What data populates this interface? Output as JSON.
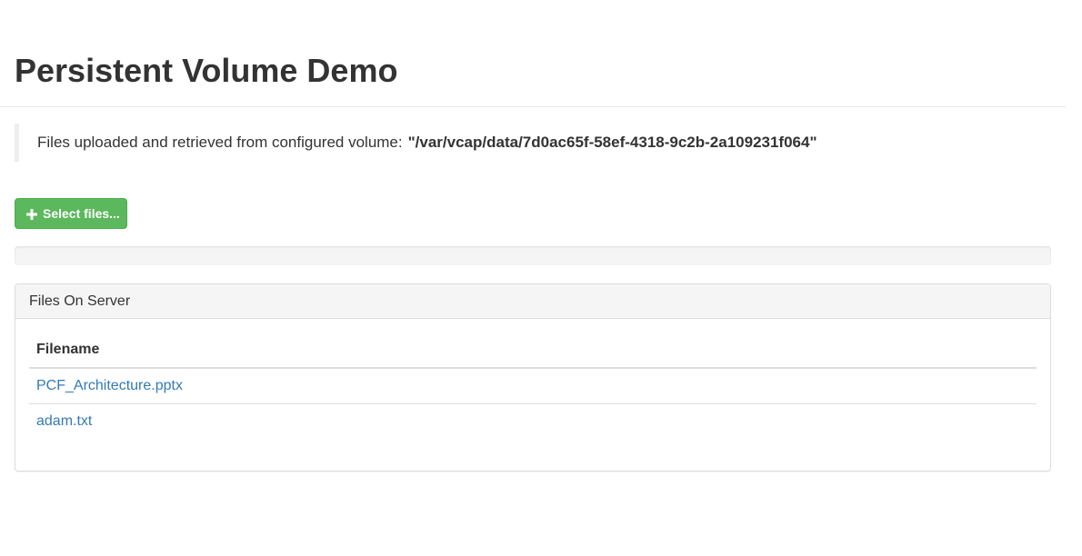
{
  "header": {
    "title": "Persistent Volume Demo"
  },
  "info": {
    "text": "Files uploaded and retrieved from configured volume:",
    "path": "\"/var/vcap/data/7d0ac65f-58ef-4318-9c2b-2a109231f064\""
  },
  "upload": {
    "button_label": "Select files...",
    "button_icon": "plus-icon",
    "button_color": "#5cb85c",
    "progress_fraction": 0
  },
  "files_panel": {
    "heading": "Files On Server",
    "column_header": "Filename",
    "files": [
      "PCF_Architecture.pptx",
      "adam.txt"
    ],
    "link_color": "#337ab7"
  }
}
